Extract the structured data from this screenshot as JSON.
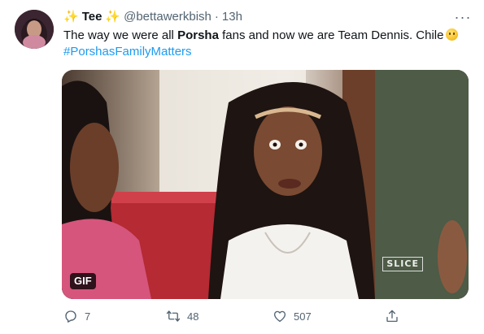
{
  "tweet": {
    "display_name": "Tee",
    "name_decoration": "✨",
    "handle": "@bettawerkbish",
    "separator": "·",
    "time": "13h",
    "text_before": "The way we were all ",
    "text_bold": "Porsha",
    "text_after": " fans and now we are Team Dennis. Chile",
    "hashtag": "#PorshasFamilyMatters",
    "media_badge": "GIF",
    "media_watermark": "SLICE",
    "more_label": "···"
  },
  "actions": {
    "reply_count": "7",
    "retweet_count": "48",
    "like_count": "507"
  },
  "icons": {
    "sparkle": "sparkle-emoji",
    "emoji": "worried-face-emoji",
    "reply": "reply-icon",
    "retweet": "retweet-icon",
    "like": "heart-icon",
    "share": "share-icon"
  },
  "colors": {
    "link": "#1d9bf0",
    "secondary_text": "#536471",
    "primary_text": "#0f1419"
  }
}
